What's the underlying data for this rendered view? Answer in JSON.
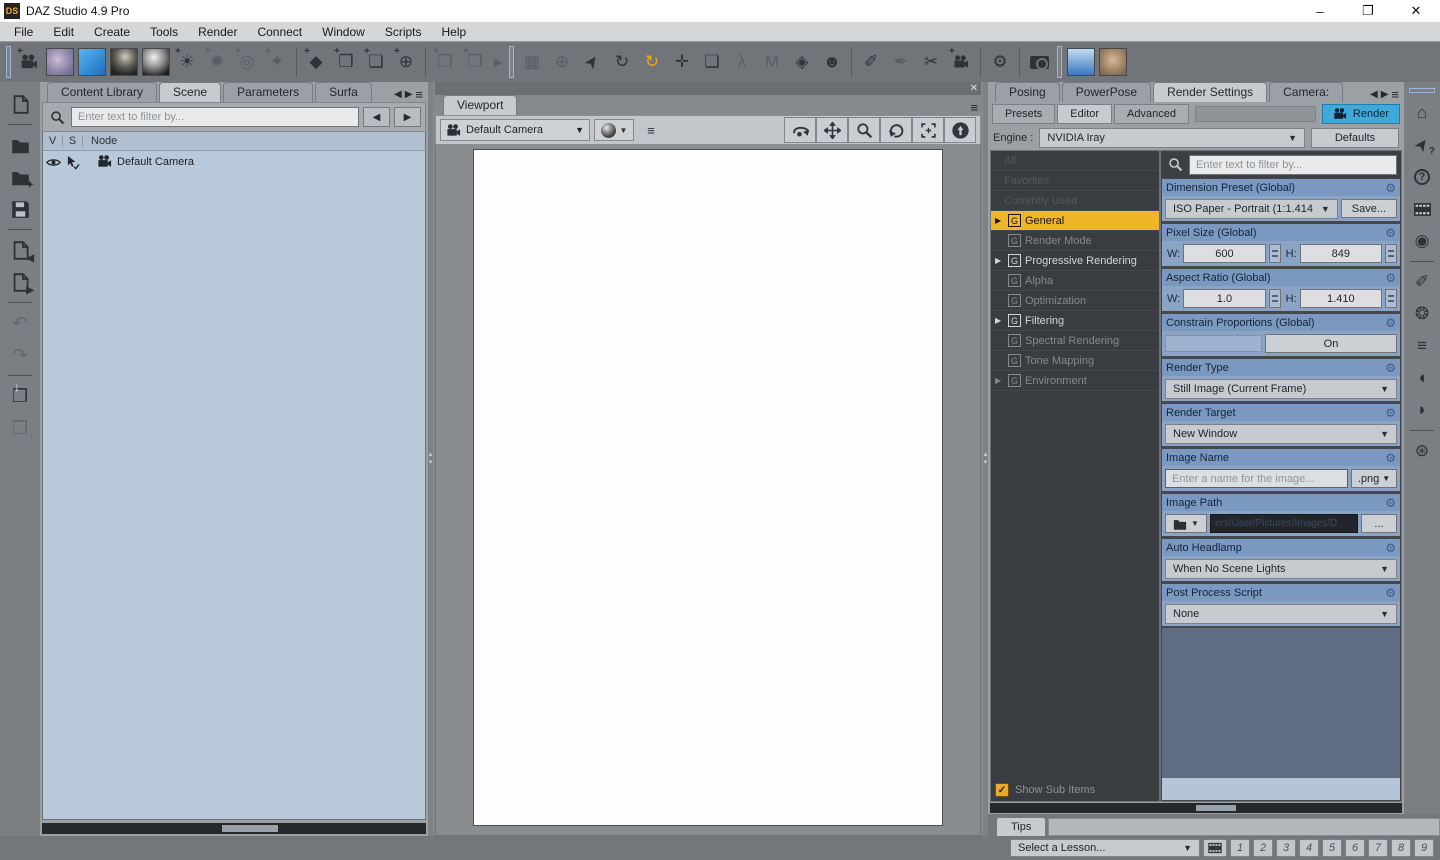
{
  "window": {
    "logo_text": "DS",
    "title": "DAZ Studio 4.9 Pro"
  },
  "menu": {
    "items": [
      "File",
      "Edit",
      "Create",
      "Tools",
      "Render",
      "Connect",
      "Window",
      "Scripts",
      "Help"
    ]
  },
  "icons": {
    "plus": "+",
    "chev_l": "◀",
    "chev_r": "▶",
    "dd": "▼",
    "close": "✕",
    "min": "–",
    "restore": "❐",
    "sun": "☀",
    "star8": "✸",
    "flash": "✹",
    "spark": "✦",
    "prim": "◆",
    "cube": "❒",
    "cube_sh": "❐",
    "sq": "❏",
    "target": "◎",
    "grid": "▦",
    "circ_cross": "⊕",
    "cursor": "➤",
    "rot": "↻",
    "cross": "✛",
    "m": "M",
    "surf": "◈",
    "fig": "☻",
    "pen": "✐",
    "pen2": "✒",
    "cut": "✂",
    "gear": "⚙",
    "home": "⌂",
    "q": "?",
    "rec": "◉",
    "burst": "❂",
    "globe": "⊛",
    "arc_l": "◖",
    "arc_r": "◗",
    "undo": "↶",
    "redo": "↷",
    "down": "↓",
    "check": "✓",
    "menu": "≡",
    "bone": "λ",
    "splitup": "▴",
    "splitdn": "▾"
  },
  "left_panel": {
    "tabs": [
      {
        "label": "Content Library"
      },
      {
        "label": "Scene"
      },
      {
        "label": "Parameters"
      },
      {
        "label": "Surfa"
      }
    ],
    "filter_placeholder": "Enter text to filter by...",
    "tree": {
      "col_v": "V",
      "col_s": "S",
      "col_node": "Node",
      "rows": [
        {
          "label": "Default Camera"
        }
      ]
    }
  },
  "viewport": {
    "tab": "Viewport",
    "camera_selector": "Default Camera"
  },
  "right_panel": {
    "tabs": [
      {
        "label": "Posing"
      },
      {
        "label": "PowerPose"
      },
      {
        "label": "Render Settings"
      },
      {
        "label": "Camera:"
      }
    ],
    "subtabs": [
      "Presets",
      "Editor",
      "Advanced"
    ],
    "render_button": "Render",
    "engine_label": "Engine :",
    "engine_value": "NVIDIA Iray",
    "defaults_button": "Defaults",
    "filter_placeholder": "Enter text to filter by...",
    "categories": [
      {
        "label": "All"
      },
      {
        "label": "Favorites"
      },
      {
        "label": "Currently Used"
      },
      {
        "label": "General",
        "badge": "G"
      },
      {
        "label": "Render Mode",
        "badge": "G"
      },
      {
        "label": "Progressive Rendering",
        "badge": "G"
      },
      {
        "label": "Alpha",
        "badge": "G"
      },
      {
        "label": "Optimization",
        "badge": "G"
      },
      {
        "label": "Filtering",
        "badge": "G"
      },
      {
        "label": "Spectral Rendering",
        "badge": "G"
      },
      {
        "label": "Tone Mapping",
        "badge": "G"
      },
      {
        "label": "Environment",
        "badge": "G"
      }
    ],
    "groups": {
      "dimension_preset": {
        "title": "Dimension Preset (Global)",
        "value": "ISO Paper - Portrait (1:1.414",
        "save": "Save..."
      },
      "pixel_size": {
        "title": "Pixel Size (Global)",
        "w_label": "W:",
        "w": "600",
        "h_label": "H:",
        "h": "849"
      },
      "aspect_ratio": {
        "title": "Aspect Ratio (Global)",
        "w_label": "W:",
        "w": "1.0",
        "h_label": "H:",
        "h": "1.410"
      },
      "constrain": {
        "title": "Constrain Proportions (Global)",
        "value": "On"
      },
      "render_type": {
        "title": "Render Type",
        "value": "Still Image (Current Frame)"
      },
      "render_target": {
        "title": "Render Target",
        "value": "New Window"
      },
      "image_name": {
        "title": "Image Name",
        "placeholder": "Enter a name for the image...",
        "ext": ".png"
      },
      "image_path": {
        "title": "Image Path",
        "value": "ers/User/Pictures/Images/D",
        "more": "..."
      },
      "auto_headlamp": {
        "title": "Auto Headlamp",
        "value": "When No Scene Lights"
      },
      "post_process": {
        "title": "Post Process Script",
        "value": "None"
      }
    },
    "show_sub_items": "Show Sub Items"
  },
  "tips": {
    "tab": "Tips",
    "lesson_placeholder": "Select a Lesson...",
    "pages": [
      "1",
      "2",
      "3",
      "4",
      "5",
      "6",
      "7",
      "8",
      "9"
    ]
  },
  "colors": {
    "accent_yellow": "#f1b52a",
    "render_blue": "#3fa9da",
    "header_blue": "#7b99c0",
    "panel_blue": "#b8c9d9"
  }
}
